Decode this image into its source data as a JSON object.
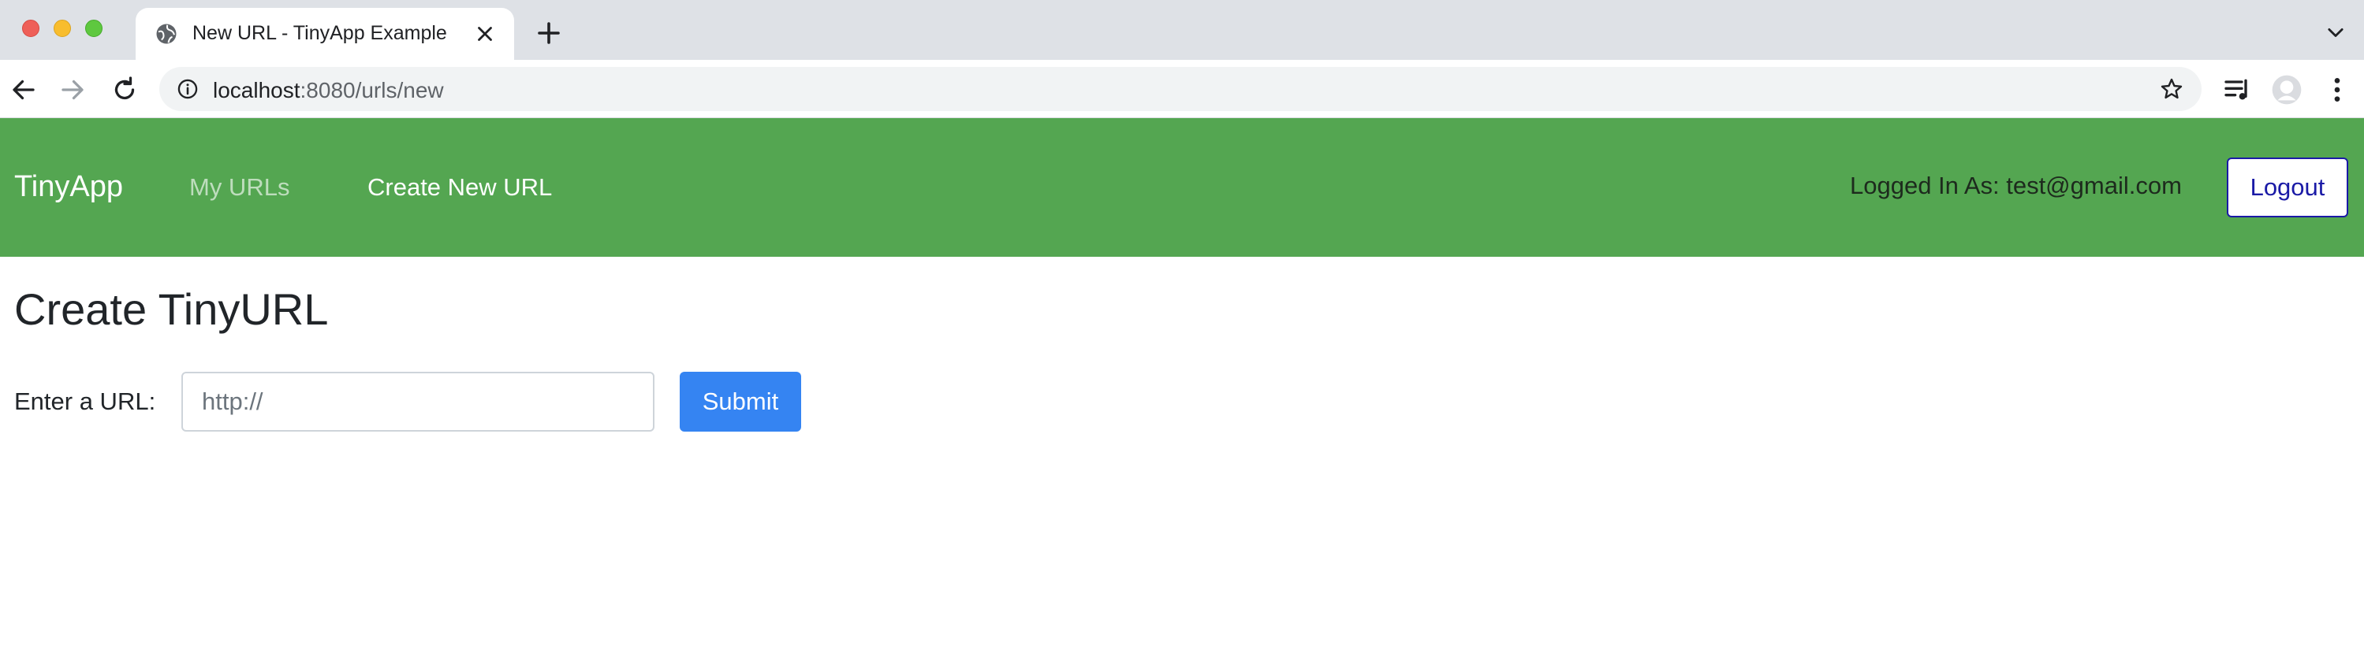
{
  "browser": {
    "tab_title": "New URL - TinyApp Example",
    "address_host": "localhost",
    "address_path": ":8080/urls/new"
  },
  "navbar": {
    "brand": "TinyApp",
    "links": [
      "My URLs",
      "Create New URL"
    ],
    "logged_in": "Logged In As: test@gmail.com",
    "logout_label": "Logout",
    "color": "#54a651"
  },
  "form": {
    "title": "Create TinyURL",
    "label": "Enter a URL:",
    "placeholder": "http://",
    "value": "",
    "submit_label": "Submit",
    "submit_color": "#3584f2"
  },
  "icons": [
    "globe-icon",
    "close-icon",
    "plus-icon",
    "chevron-down-icon",
    "back-arrow-icon",
    "forward-arrow-icon",
    "reload-icon",
    "info-icon",
    "star-icon",
    "media-queue-icon",
    "profile-avatar-icon",
    "more-vert-icon"
  ]
}
